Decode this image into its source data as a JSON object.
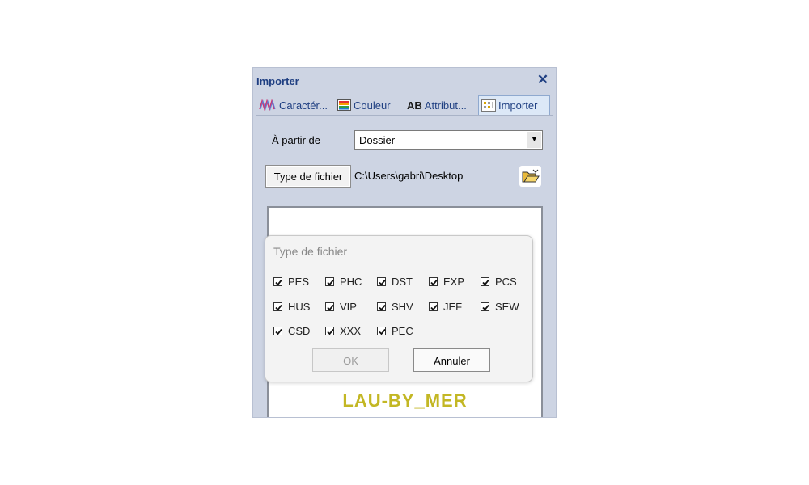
{
  "window": {
    "title": "Importer",
    "close_glyph": "✕"
  },
  "tabs": [
    {
      "label": "Caractér...",
      "icon": "thread-icon"
    },
    {
      "label": "Couleur",
      "icon": "color-palette-icon"
    },
    {
      "label": "Attribut...",
      "icon": "ab-text-icon",
      "icon_text": "AB"
    },
    {
      "label": "Importer",
      "icon": "grid-import-icon",
      "active": true
    }
  ],
  "import": {
    "source_label": "À partir de",
    "source_value": "Dossier",
    "filetype_button": "Type de fichier",
    "path": "C:\\Users\\gabri\\Desktop"
  },
  "watermark": "LAU-BY_MER",
  "dialog": {
    "title": "Type de fichier",
    "filetypes": [
      {
        "label": "PES",
        "checked": true
      },
      {
        "label": "PHC",
        "checked": true
      },
      {
        "label": "DST",
        "checked": true
      },
      {
        "label": "EXP",
        "checked": true
      },
      {
        "label": "PCS",
        "checked": true
      },
      {
        "label": "HUS",
        "checked": true
      },
      {
        "label": "VIP",
        "checked": true
      },
      {
        "label": "SHV",
        "checked": true
      },
      {
        "label": "JEF",
        "checked": true
      },
      {
        "label": "SEW",
        "checked": true
      },
      {
        "label": "CSD",
        "checked": true
      },
      {
        "label": "XXX",
        "checked": true
      },
      {
        "label": "PEC",
        "checked": true
      }
    ],
    "ok_label": "OK",
    "cancel_label": "Annuler"
  },
  "colors": {
    "accent": "#1f3f82",
    "panel": "#cdd4e3",
    "watermark": "#c3b724"
  }
}
